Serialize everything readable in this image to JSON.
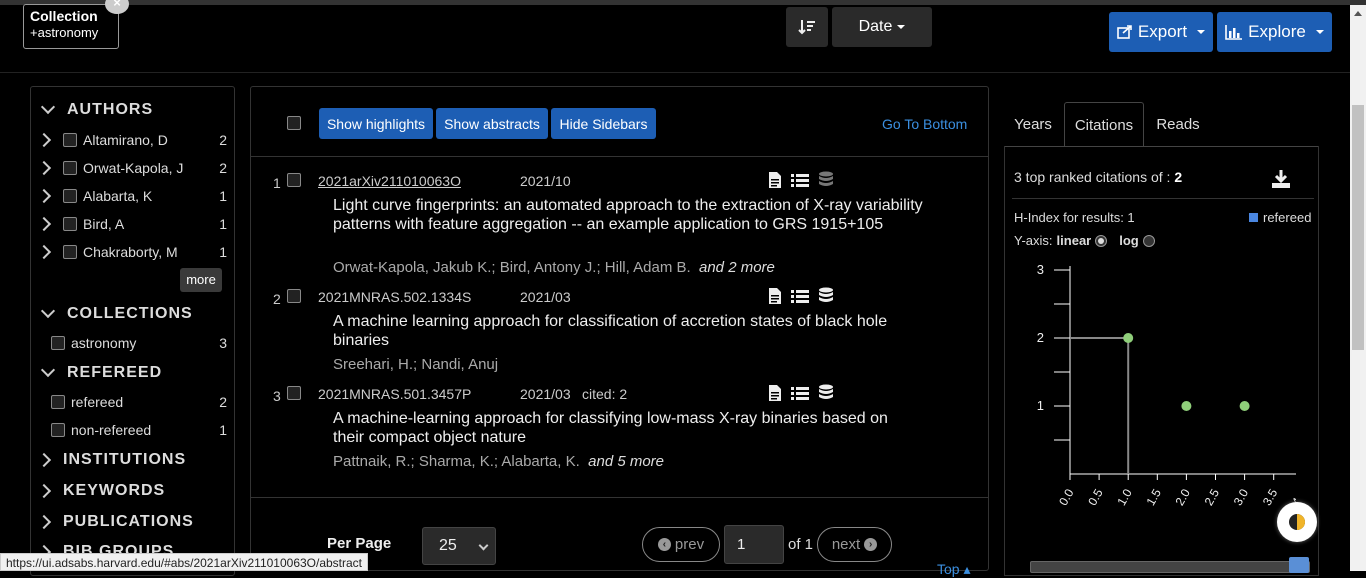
{
  "collection_chip": {
    "title": "Collection",
    "value": "+astronomy",
    "close": "×"
  },
  "sort": {
    "field": "Date"
  },
  "header": {
    "export_label": "Export",
    "explore_label": "Explore"
  },
  "facets": {
    "authors": {
      "title": "AUTHORS",
      "items": [
        {
          "label": "Altamirano, D",
          "count": "2"
        },
        {
          "label": "Orwat-Kapola, J",
          "count": "2"
        },
        {
          "label": "Alabarta, K",
          "count": "1"
        },
        {
          "label": "Bird, A",
          "count": "1"
        },
        {
          "label": "Chakraborty, M",
          "count": "1"
        }
      ],
      "more_label": "more"
    },
    "collections": {
      "title": "COLLECTIONS",
      "items": [
        {
          "label": "astronomy",
          "count": "3"
        }
      ]
    },
    "refereed": {
      "title": "REFEREED",
      "items": [
        {
          "label": "refereed",
          "count": "2"
        },
        {
          "label": "non-refereed",
          "count": "1"
        }
      ]
    },
    "institutions": {
      "title": "INSTITUTIONS"
    },
    "keywords": {
      "title": "KEYWORDS"
    },
    "publications": {
      "title": "PUBLICATIONS"
    },
    "bibgroups": {
      "title": "BIB GROUPS"
    }
  },
  "toolbar": {
    "show_highlights": "Show highlights",
    "show_abstracts": "Show abstracts",
    "hide_sidebars": "Hide Sidebars",
    "go_to_bottom": "Go To Bottom"
  },
  "results": [
    {
      "num": "1",
      "bibcode": "2021arXiv211010063O",
      "date": "2021/10",
      "cited": "",
      "title": "Light curve fingerprints: an automated approach to the extraction of X-ray variability patterns with feature aggregation -- an example application to GRS 1915+105",
      "authors": "Orwat-Kapola, Jakub K.;  Bird, Antony J.;  Hill, Adam B.",
      "more": "and 2 more"
    },
    {
      "num": "2",
      "bibcode": "2021MNRAS.502.1334S",
      "date": "2021/03",
      "cited": "",
      "title": "A machine learning approach for classification of accretion states of black hole binaries",
      "authors": "Sreehari, H.;  Nandi, Anuj",
      "more": ""
    },
    {
      "num": "3",
      "bibcode": "2021MNRAS.501.3457P",
      "date": "2021/03",
      "cited": "cited: 2",
      "title": "A machine-learning approach for classifying low-mass X-ray binaries based on their compact object nature",
      "authors": "Pattnaik, R.;  Sharma, K.;  Alabarta, K.",
      "more": "and 5 more"
    }
  ],
  "pagination": {
    "per_page_label": "Per Page",
    "per_page_value": "25",
    "prev": "prev",
    "page": "1",
    "of": "of 1",
    "next": "next",
    "top_link": "Top"
  },
  "metrics": {
    "tabs": [
      "Years",
      "Citations",
      "Reads"
    ],
    "active_tab": "Citations",
    "heading_prefix": "3 top ranked citations of :",
    "heading_value": "2",
    "hindex": "H-Index for results: 1",
    "legend_label": "refereed",
    "legend_color": "#4a86e0",
    "yaxis_label": "Y-axis:",
    "yaxis_linear": "linear",
    "yaxis_log": "log"
  },
  "chart_data": {
    "type": "scatter",
    "x": [
      1,
      2,
      3
    ],
    "y": [
      2,
      1,
      1
    ],
    "yticks": [
      "3",
      "2",
      "1"
    ],
    "xticks": [
      "0.0",
      "0.5",
      "1.0",
      "1.5",
      "2.0",
      "2.5",
      "3.0",
      "3.5",
      "4.0"
    ],
    "ylim": [
      0,
      3
    ],
    "xlim": [
      0,
      4
    ],
    "h_index": 1,
    "color": "#8fce7a"
  },
  "status_url": "https://ui.adsabs.harvard.edu/#abs/2021arXiv211010063O/abstract"
}
